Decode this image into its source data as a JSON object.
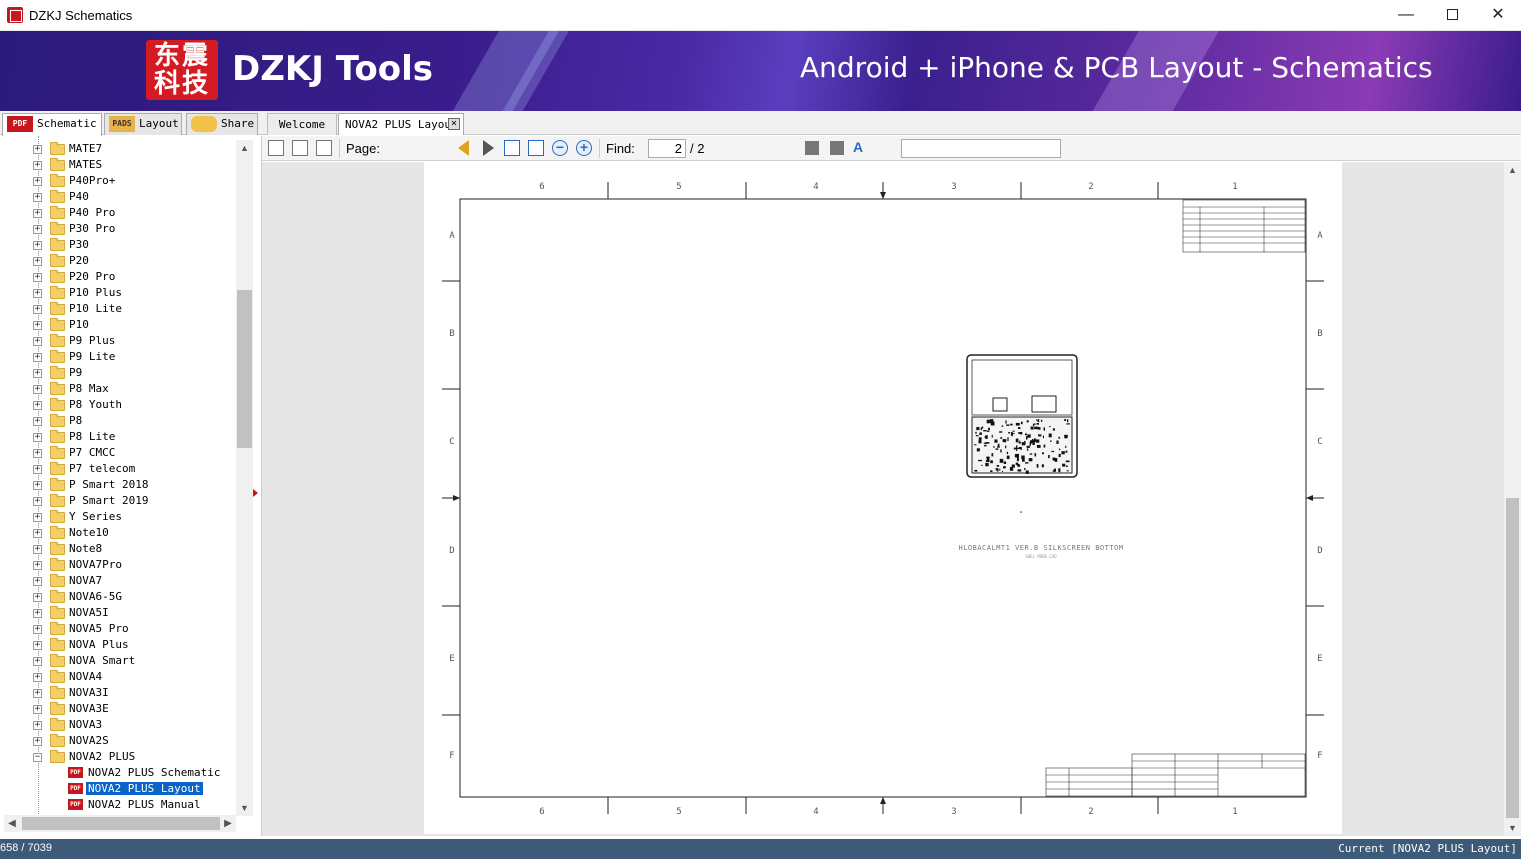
{
  "window": {
    "title": "DZKJ Schematics",
    "min_glyph": "—",
    "close_glyph": "✕"
  },
  "banner": {
    "logo_line1": "东震",
    "logo_line2": "科技",
    "brand": "DZKJ Tools",
    "slogan": "Android + iPhone & PCB Layout - Schematics"
  },
  "left_tabs": [
    {
      "label": "Schematic",
      "icon": "PDF"
    },
    {
      "label": "Layout",
      "icon": "PADS"
    },
    {
      "label": "Share",
      "icon": "share-icon"
    }
  ],
  "doc_tabs": [
    {
      "label": "Welcome"
    },
    {
      "label": "NOVA2 PLUS Layout"
    }
  ],
  "tree": {
    "folders": [
      "MATE7",
      "MATES",
      "P40Pro+",
      "P40",
      "P40 Pro",
      "P30 Pro",
      "P30",
      "P20",
      "P20 Pro",
      "P10 Plus",
      "P10 Lite",
      "P10",
      "P9 Plus",
      "P9 Lite",
      "P9",
      "P8 Max",
      "P8 Youth",
      "P8",
      "P8 Lite",
      "P7 CMCC",
      "P7 telecom",
      "P Smart 2018",
      "P Smart 2019",
      "Y Series",
      "Note10",
      "Note8",
      "NOVA7Pro",
      "NOVA7",
      "NOVA6-5G",
      "NOVA5I",
      "NOVA5 Pro",
      "NOVA Plus",
      "NOVA Smart",
      "NOVA4",
      "NOVA3I",
      "NOVA3E",
      "NOVA3",
      "NOVA2S",
      "NOVA2 PLUS"
    ],
    "children": [
      "NOVA2 PLUS Schematic",
      "NOVA2 PLUS Layout",
      "NOVA2 PLUS Manual"
    ],
    "selected": "NOVA2 PLUS Layout"
  },
  "toolbar": {
    "page_label": "Page:",
    "page_current": "2",
    "page_total": "/ 2",
    "find_label": "Find:",
    "find_value": ""
  },
  "sheet": {
    "col_labels": [
      "6",
      "5",
      "4",
      "3",
      "2",
      "1"
    ],
    "row_labels": [
      "A",
      "B",
      "C",
      "D",
      "E",
      "F"
    ],
    "caption": "HLOBACALMT1 VER.B SILKSCREEN BOTTOM",
    "sub_caption": "SHEL MOBE.CAD"
  },
  "status": {
    "left": "658 / 7039",
    "right": "Current [NOVA2 PLUS Layout]"
  }
}
